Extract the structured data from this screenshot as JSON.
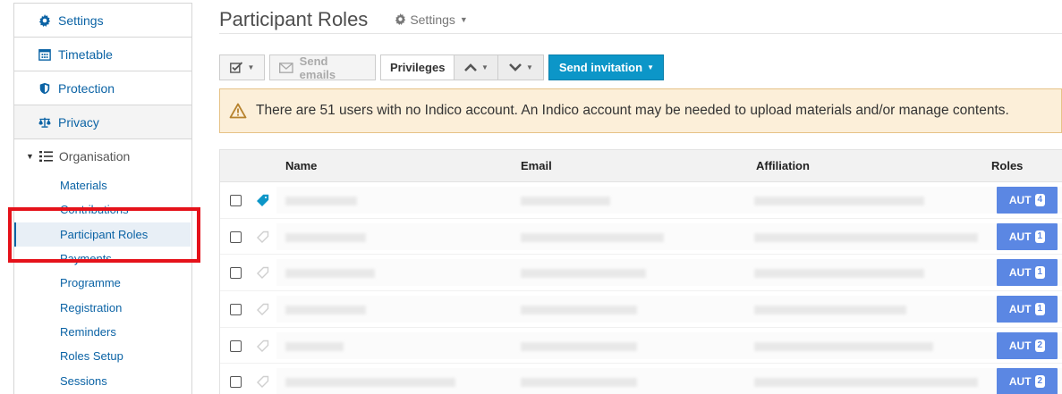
{
  "sidebar": {
    "items": [
      {
        "label": "Settings",
        "icon": "gear-icon"
      },
      {
        "label": "Timetable",
        "icon": "calendar-icon"
      },
      {
        "label": "Protection",
        "icon": "shield-icon"
      },
      {
        "label": "Privacy",
        "icon": "scales-icon"
      }
    ],
    "org_label": "Organisation",
    "sub_items": [
      "Materials",
      "Contributions",
      "Participant Roles",
      "Payments",
      "Programme",
      "Registration",
      "Reminders",
      "Roles Setup",
      "Sessions"
    ],
    "active_sub": "Participant Roles"
  },
  "header": {
    "title": "Participant Roles",
    "settings_label": "Settings"
  },
  "toolbar": {
    "send_emails": "Send emails",
    "privileges": "Privileges",
    "send_invitation": "Send invitation"
  },
  "warning": {
    "text": "There are 51 users with no Indico account. An Indico account may be needed to upload materials and/or manage contents."
  },
  "table": {
    "columns": {
      "name": "Name",
      "email": "Email",
      "affiliation": "Affiliation",
      "roles": "Roles"
    },
    "rows": [
      {
        "role": "AUT",
        "count": "4",
        "linked": true
      },
      {
        "role": "AUT",
        "count": "1",
        "linked": false
      },
      {
        "role": "AUT",
        "count": "1",
        "linked": false
      },
      {
        "role": "AUT",
        "count": "1",
        "linked": false
      },
      {
        "role": "AUT",
        "count": "2",
        "linked": false
      },
      {
        "role": "AUT",
        "count": "2",
        "linked": false
      }
    ]
  },
  "colors": {
    "link": "#0b63a5",
    "primary": "#0c96c8",
    "badge": "#5b87e3",
    "warning_bg": "#fcefd9",
    "highlight": "#e5121a"
  }
}
